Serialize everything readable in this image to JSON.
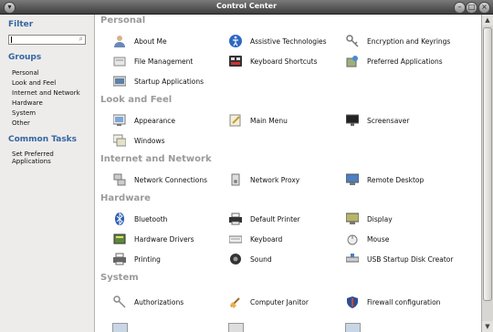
{
  "window": {
    "title": "Control Center"
  },
  "sidebar": {
    "filter_label": "Filter",
    "search_value": "",
    "groups_label": "Groups",
    "groups": [
      "Personal",
      "Look and Feel",
      "Internet and Network",
      "Hardware",
      "System",
      "Other"
    ],
    "tasks_label": "Common Tasks",
    "tasks": [
      "Set Preferred Applications"
    ]
  },
  "sections": [
    {
      "title": "Personal",
      "items": [
        {
          "label": "About Me",
          "icon": "person-icon"
        },
        {
          "label": "Assistive Technologies",
          "icon": "accessibility-icon"
        },
        {
          "label": "Encryption and Keyrings",
          "icon": "keyring-icon"
        },
        {
          "label": "File Management",
          "icon": "file-manager-icon"
        },
        {
          "label": "Keyboard Shortcuts",
          "icon": "keyboard-shortcuts-icon"
        },
        {
          "label": "Preferred Applications",
          "icon": "preferred-apps-icon"
        },
        {
          "label": "Startup Applications",
          "icon": "startup-apps-icon"
        }
      ]
    },
    {
      "title": "Look and Feel",
      "items": [
        {
          "label": "Appearance",
          "icon": "appearance-icon"
        },
        {
          "label": "Main Menu",
          "icon": "main-menu-icon"
        },
        {
          "label": "Screensaver",
          "icon": "screensaver-icon"
        },
        {
          "label": "Windows",
          "icon": "windows-icon"
        }
      ]
    },
    {
      "title": "Internet and Network",
      "items": [
        {
          "label": "Network Connections",
          "icon": "network-icon"
        },
        {
          "label": "Network Proxy",
          "icon": "proxy-icon"
        },
        {
          "label": "Remote Desktop",
          "icon": "remote-desktop-icon"
        }
      ]
    },
    {
      "title": "Hardware",
      "items": [
        {
          "label": "Bluetooth",
          "icon": "bluetooth-icon"
        },
        {
          "label": "Default Printer",
          "icon": "printer-icon"
        },
        {
          "label": "Display",
          "icon": "display-icon"
        },
        {
          "label": "Hardware Drivers",
          "icon": "drivers-icon"
        },
        {
          "label": "Keyboard",
          "icon": "keyboard-icon"
        },
        {
          "label": "Mouse",
          "icon": "mouse-icon"
        },
        {
          "label": "Printing",
          "icon": "printing-icon"
        },
        {
          "label": "Sound",
          "icon": "sound-icon"
        },
        {
          "label": "USB Startup Disk Creator",
          "icon": "usb-disk-icon"
        }
      ]
    },
    {
      "title": "System",
      "items": [
        {
          "label": "Authorizations",
          "icon": "authorizations-icon"
        },
        {
          "label": "Computer Janitor",
          "icon": "janitor-icon"
        },
        {
          "label": "Firewall configuration",
          "icon": "firewall-icon"
        }
      ]
    }
  ]
}
